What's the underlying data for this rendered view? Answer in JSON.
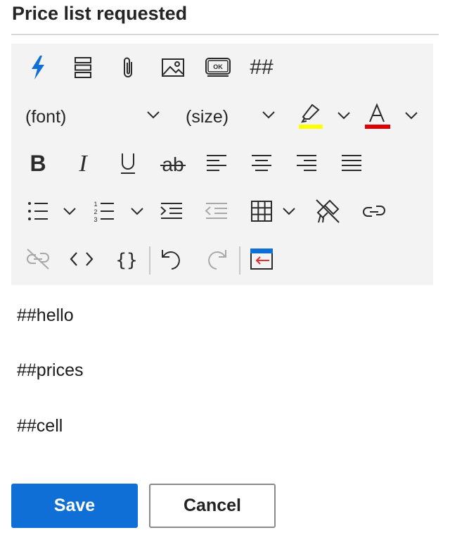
{
  "header": {
    "title": "Price list requested"
  },
  "toolbar": {
    "font_dropdown": {
      "value": "(font)"
    },
    "size_dropdown": {
      "value": "(size)"
    },
    "placeholder_button_label": "##",
    "ok_icon_text": "OK",
    "highlight_color": "#ffff00",
    "font_color": "#e00000",
    "accent_color": "#0f6fd6"
  },
  "editor": {
    "lines": [
      "##hello",
      "##prices",
      "##cell"
    ]
  },
  "actions": {
    "save_label": "Save",
    "cancel_label": "Cancel"
  }
}
